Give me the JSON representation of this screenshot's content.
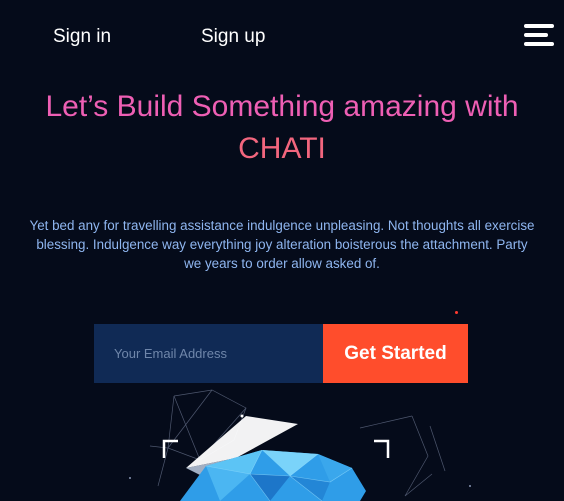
{
  "nav": {
    "sign_in": "Sign in",
    "sign_up": "Sign up",
    "menu_icon": "hamburger-menu-icon"
  },
  "hero": {
    "headline_line1": "Let’s Build Something amazing with",
    "headline_line2": "CHATI",
    "description_lines": [
      "Yet bed any for travelling assistance indulgence unpleasing. Not thoughts all exercise",
      "blessing. Indulgence way everything joy alteration boisterous the attachment. Party",
      "we years to order allow asked of."
    ]
  },
  "form": {
    "email_placeholder": "Your Email Address",
    "email_value": "",
    "submit_label": "Get Started"
  },
  "colors": {
    "background": "#050b1a",
    "headline_pink": "#ee5fb4",
    "headline_coral": "#f2667e",
    "description": "#8fb6f0",
    "input_bg": "#102a55",
    "cta_bg": "#ff4d2c",
    "crystal_blue": "#2f9de8"
  }
}
